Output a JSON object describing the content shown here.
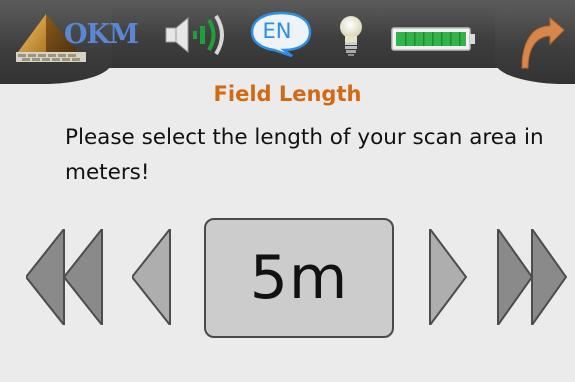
{
  "header": {
    "logo_text": "OKM",
    "language": "EN",
    "icons": {
      "speaker": "speaker-volume-icon",
      "language": "language-bubble-icon",
      "light": "lightbulb-icon",
      "battery": "battery-full-icon",
      "back": "back-arrow-icon"
    },
    "battery_level": 1.0
  },
  "screen": {
    "title": "Field Length",
    "instruction": "Please select the length of your scan area in meters!",
    "value": "5m"
  },
  "colors": {
    "title": "#d26a14",
    "language": "#2d8fe4",
    "battery": "#33b34a",
    "back": "#d8874a",
    "volume": "#1f9e3a"
  }
}
